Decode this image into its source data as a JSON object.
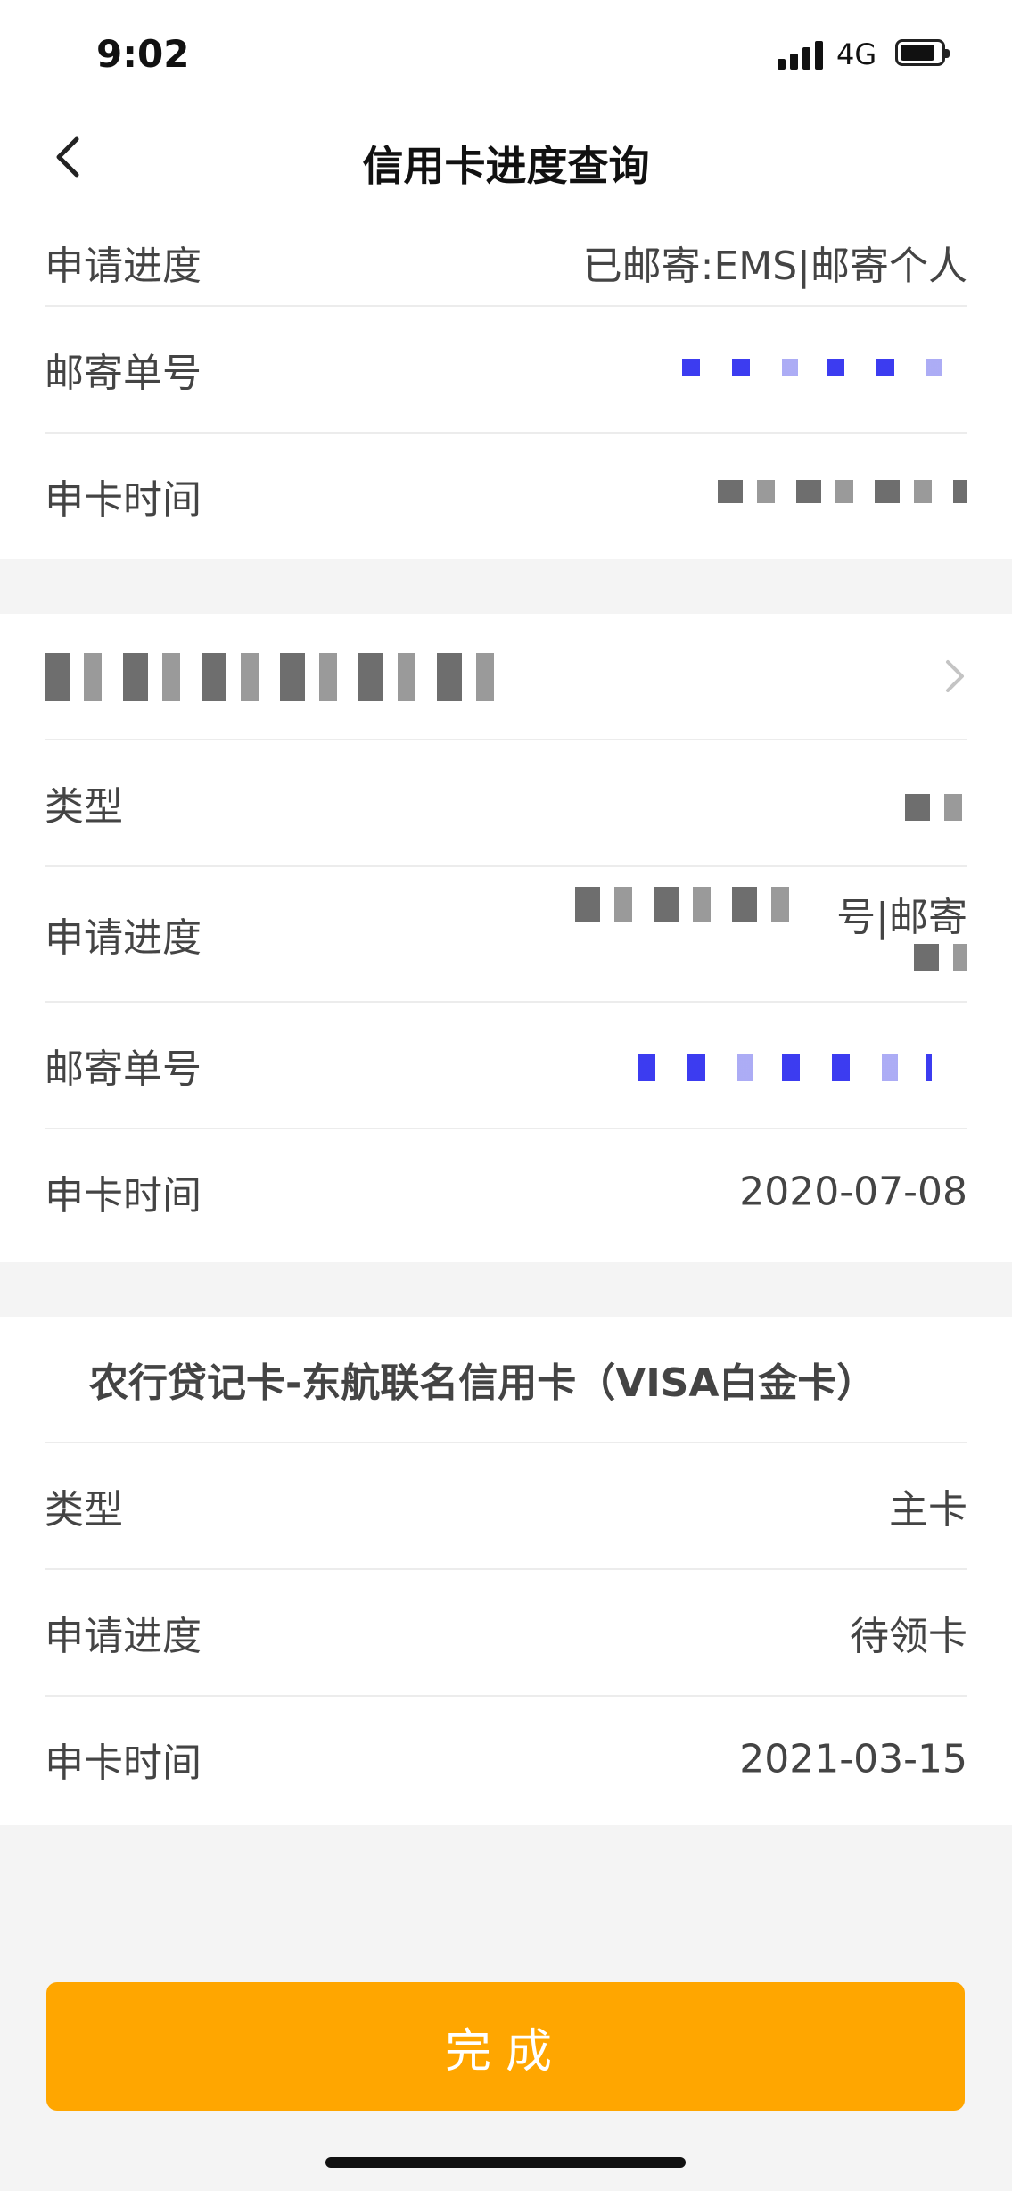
{
  "status_bar": {
    "time": "9:02",
    "network": "4G"
  },
  "nav": {
    "title": "信用卡进度查询",
    "back_icon": "chevron-left-icon"
  },
  "card1": {
    "rows": [
      {
        "label": "申请进度",
        "value": "已邮寄:EMS|邮寄个人"
      },
      {
        "label": "邮寄单号",
        "value": ""
      },
      {
        "label": "申卡时间",
        "value": ""
      }
    ]
  },
  "card2": {
    "title": "",
    "rows": [
      {
        "label": "类型",
        "value": ""
      },
      {
        "label": "申请进度",
        "value": "号|邮寄"
      },
      {
        "label": "邮寄单号",
        "value": ""
      },
      {
        "label": "申卡时间",
        "value": "2020-07-08"
      }
    ]
  },
  "card3": {
    "title": "农行贷记卡-东航联名信用卡（VISA白金卡）",
    "rows": [
      {
        "label": "类型",
        "value": "主卡"
      },
      {
        "label": "申请进度",
        "value": "待领卡"
      },
      {
        "label": "申卡时间",
        "value": "2021-03-15"
      }
    ]
  },
  "footer": {
    "done_label": "完成"
  },
  "colors": {
    "accent": "#ffa600",
    "background": "#f4f4f4"
  }
}
